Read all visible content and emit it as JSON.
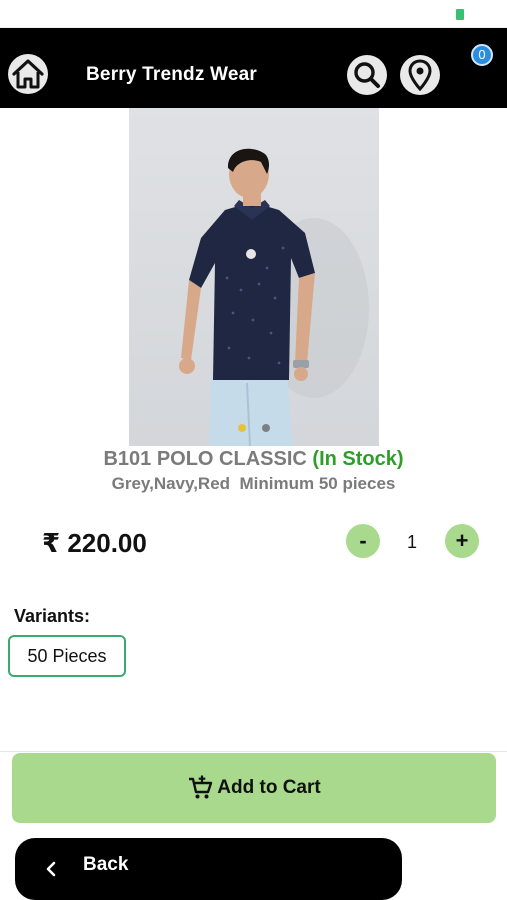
{
  "header": {
    "title": "Berry Trendz Wear",
    "cart_count": "0",
    "icons": [
      "home-icon",
      "search-icon",
      "location-pin-icon"
    ]
  },
  "product": {
    "name": "B101 POLO CLASSIC",
    "stock_status": "(In Stock)",
    "details": "Grey,Navy,Red  Minimum 50 pieces",
    "price": "₹ 220.00",
    "image_alt": "Model wearing navy printed polo shirt",
    "carousel_dots": 2,
    "active_dot": 0
  },
  "quantity": {
    "minus_label": "-",
    "value": "1",
    "plus_label": "+"
  },
  "variants": {
    "label": "Variants:",
    "options": [
      "50 Pieces"
    ],
    "selected": "50 Pieces"
  },
  "actions": {
    "add_to_cart": "Add to Cart",
    "back": "Back"
  },
  "colors": {
    "header_bg": "#000000",
    "accent_green": "#a8d98c",
    "stock_green": "#2f9d2a",
    "badge_blue": "#2b8de0",
    "variant_border": "#3aab6c"
  }
}
